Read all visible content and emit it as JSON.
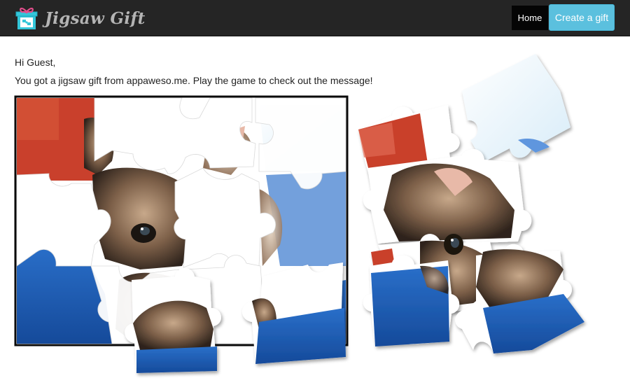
{
  "app": {
    "name": "Jigsaw Gift"
  },
  "nav": {
    "home_label": "Home",
    "create_label": "Create a gift"
  },
  "content": {
    "greeting": "Hi Guest,",
    "message": "You got a jigsaw gift from appaweso.me. Play the game to check out the message!"
  },
  "colors": {
    "navbar_bg": "#252525",
    "brand_text": "#b4b4b4",
    "create_button": "#5bc0de",
    "home_active": "#050505"
  },
  "icons": {
    "logo": "gift-box-logo-icon"
  },
  "puzzle": {
    "subject": "kitten photo",
    "board_pieces_count_shown": 9,
    "loose_pieces_count_shown": 6
  }
}
